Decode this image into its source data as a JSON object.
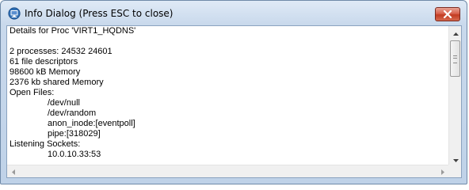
{
  "window": {
    "title": "Info Dialog (Press ESC to close)",
    "icons": {
      "app": "info-dialog-app-icon",
      "close": "close-icon"
    }
  },
  "content": {
    "lines": [
      {
        "text": "Details for Proc 'VIRT1_HQDNS'",
        "indent": false
      },
      {
        "text": "",
        "indent": false
      },
      {
        "text": "2 processes: 24532 24601",
        "indent": false
      },
      {
        "text": "61 file descriptors",
        "indent": false
      },
      {
        "text": "98600 kB Memory",
        "indent": false
      },
      {
        "text": "2376 kb shared Memory",
        "indent": false
      },
      {
        "text": "Open Files:",
        "indent": false
      },
      {
        "text": "/dev/null",
        "indent": true
      },
      {
        "text": "/dev/random",
        "indent": true
      },
      {
        "text": "anon_inode:[eventpoll]",
        "indent": true
      },
      {
        "text": "pipe:[318029]",
        "indent": true
      },
      {
        "text": "Listening Sockets:",
        "indent": false
      },
      {
        "text": "10.0.10.33:53",
        "indent": true
      }
    ]
  },
  "scrollbars": {
    "vertical_position": 0.0,
    "horizontal_position": 0.0
  }
}
